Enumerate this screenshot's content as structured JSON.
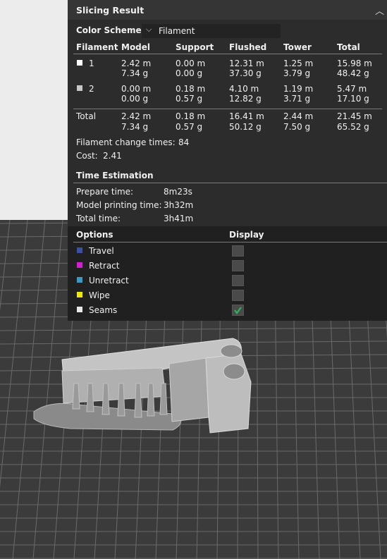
{
  "panel": {
    "title": "Slicing Result",
    "collapse_icon": "chevron-up-icon",
    "color_scheme_label": "Color Scheme",
    "color_scheme_value": "Filament",
    "headers": [
      "Filament",
      "Model",
      "Support",
      "Flushed",
      "Tower",
      "Total"
    ],
    "rows": [
      {
        "label": "1",
        "color": "#ffffff",
        "model": [
          "2.42 m",
          "7.34 g"
        ],
        "support": [
          "0.00 m",
          "0.00 g"
        ],
        "flushed": [
          "12.31 m",
          "37.30 g"
        ],
        "tower": [
          "1.25 m",
          "3.79 g"
        ],
        "total": [
          "15.98 m",
          "48.42 g"
        ]
      },
      {
        "label": "2",
        "color": "#c8c8c8",
        "model": [
          "0.00 m",
          "0.00 g"
        ],
        "support": [
          "0.18 m",
          "0.57 g"
        ],
        "flushed": [
          "4.10 m",
          "12.82 g"
        ],
        "tower": [
          "1.19 m",
          "3.71 g"
        ],
        "total": [
          "5.47 m",
          "17.10 g"
        ]
      }
    ],
    "total_row": {
      "label": "Total",
      "model": [
        "2.42 m",
        "7.34 g"
      ],
      "support": [
        "0.18 m",
        "0.57 g"
      ],
      "flushed": [
        "16.41 m",
        "50.12 g"
      ],
      "tower": [
        "2.44 m",
        "7.50 g"
      ],
      "total": [
        "21.45 m",
        "65.52 g"
      ]
    },
    "filament_change_label": "Filament change times:",
    "filament_change_value": "84",
    "cost_label": "Cost:",
    "cost_value": "2.41",
    "time_estimation_title": "Time Estimation",
    "times": [
      {
        "label": "Prepare time:",
        "value": "8m23s"
      },
      {
        "label": "Model printing time:",
        "value": "3h32m"
      },
      {
        "label": "Total time:",
        "value": "3h41m"
      }
    ],
    "options_header": "Options",
    "display_header": "Display",
    "options": [
      {
        "label": "Travel",
        "color": "#3b4ea8",
        "checked": false
      },
      {
        "label": "Retract",
        "color": "#d41ed6",
        "checked": false
      },
      {
        "label": "Unretract",
        "color": "#3a9ac4",
        "checked": false
      },
      {
        "label": "Wipe",
        "color": "#f0e800",
        "checked": false
      },
      {
        "label": "Seams",
        "color": "#e8e8e8",
        "checked": true
      }
    ]
  }
}
